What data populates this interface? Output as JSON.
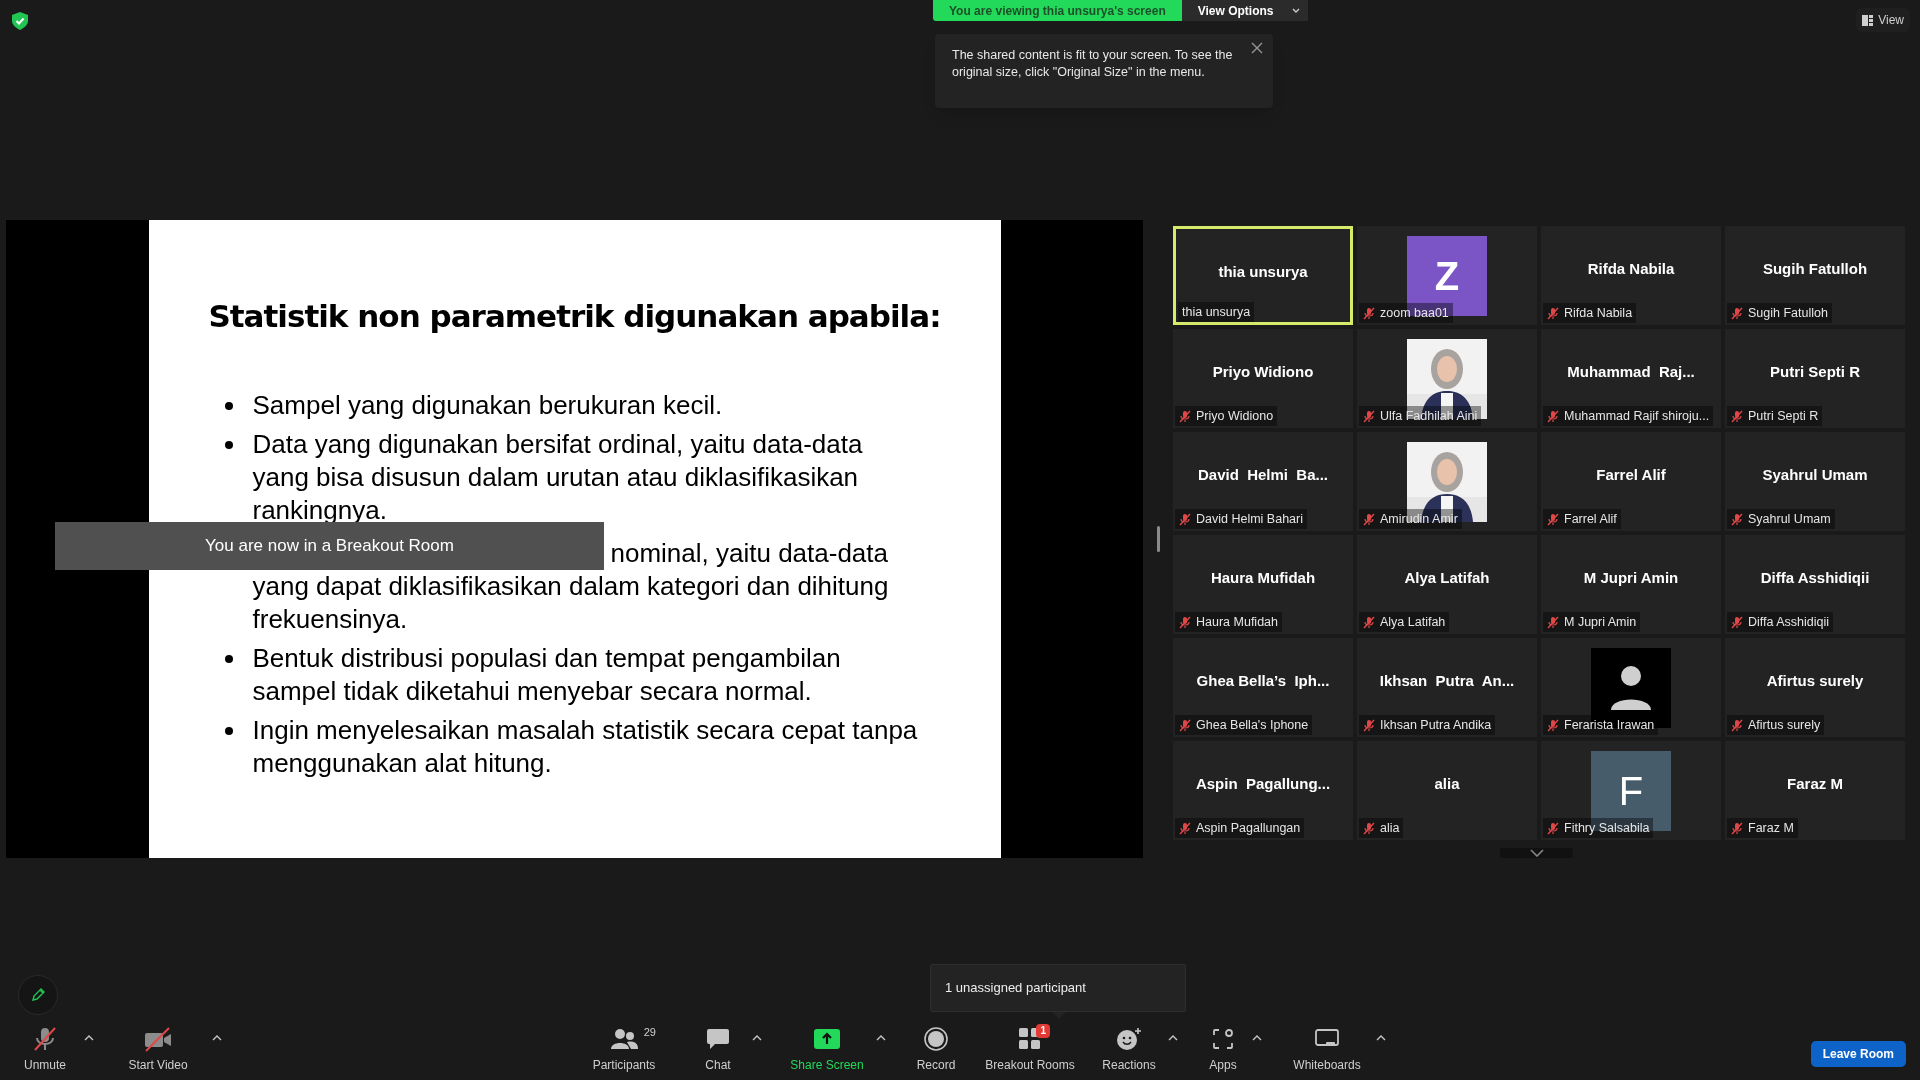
{
  "banner": {
    "text": "You are viewing thia unsurya's screen",
    "menu": "View Options"
  },
  "tooltip": {
    "text": "The shared content is fit to your screen. To see the original size, click \"Original Size\" in the menu."
  },
  "view_button": "View",
  "slide": {
    "title": "Statistik non parametrik digunakan apabila:",
    "bullets": [
      {
        "covered": false,
        "lines": [
          "Sampel yang digunakan berukuran kecil."
        ]
      },
      {
        "covered": false,
        "lines": [
          "Data yang digunakan bersifat ordinal, yaitu data-data",
          "yang bisa disusun dalam urutan atau diklasifikasikan",
          "rankingnya."
        ]
      },
      {
        "covered": true,
        "lines": [
          "nominal, yaitu data-data",
          "yang dapat diklasifikasikan dalam kategori dan dihitung",
          "frekuensinya."
        ]
      },
      {
        "covered": false,
        "lines": [
          "Bentuk distribusi populasi dan tempat pengambilan",
          "sampel tidak diketahui menyebar secara normal."
        ]
      },
      {
        "covered": false,
        "lines": [
          "Ingin menyelesaikan masalah statistik secara cepat tanpa",
          "menggunakan alat hitung."
        ]
      }
    ]
  },
  "notice": "You are now in a Breakout Room",
  "gallery": [
    {
      "kind": "name",
      "title": "thia unsurya",
      "label": "thia unsurya",
      "muted": false,
      "selected": true
    },
    {
      "kind": "letter",
      "letter": "Z",
      "color": "#7b55c6",
      "label": "zoom baa01",
      "muted": true,
      "selected": false
    },
    {
      "kind": "name",
      "title": "Rifda Nabila",
      "label": "Rifda Nabila",
      "muted": true,
      "selected": false
    },
    {
      "kind": "name",
      "title": "Sugih Fatulloh",
      "label": "Sugih Fatulloh",
      "muted": true,
      "selected": false
    },
    {
      "kind": "name",
      "title": "Priyo Widiono",
      "label": "Priyo Widiono",
      "muted": true,
      "selected": false
    },
    {
      "label": "Ulfa Fadhilah Aini",
      "muted": true,
      "selected": false
    },
    {
      "kind": "name",
      "title": "Muhammad  Raj...",
      "label": "Muhammad Rajif shiroju...",
      "muted": true,
      "selected": false
    },
    {
      "kind": "name",
      "title": "Putri Septi R",
      "label": "Putri Septi R",
      "muted": true,
      "selected": false
    },
    {
      "kind": "name",
      "title": "David  Helmi  Ba...",
      "label": "David Helmi Bahari",
      "muted": true,
      "selected": false
    },
    {
      "label": "Amirudin Amir",
      "muted": true,
      "selected": false
    },
    {
      "kind": "name",
      "title": "Farrel Alif",
      "label": "Farrel Alif",
      "muted": true,
      "selected": false
    },
    {
      "kind": "name",
      "title": "Syahrul Umam",
      "label": "Syahrul Umam",
      "muted": true,
      "selected": false
    },
    {
      "kind": "name",
      "title": "Haura Mufidah",
      "label": "Haura Mufidah",
      "muted": true,
      "selected": false
    },
    {
      "kind": "name",
      "title": "Alya Latifah",
      "label": "Alya Latifah",
      "muted": true,
      "selected": false
    },
    {
      "kind": "name",
      "title": "M Jupri Amin",
      "label": "M Jupri Amin",
      "muted": true,
      "selected": false
    },
    {
      "kind": "name",
      "title": "Diffa Asshidiqii",
      "label": "Diffa Asshidiqii",
      "muted": true,
      "selected": false
    },
    {
      "kind": "name",
      "title": "Ghea Bella’s  Iph...",
      "label": "Ghea Bella's Iphone",
      "muted": true,
      "selected": false
    },
    {
      "kind": "name",
      "title": "Ikhsan  Putra  An...",
      "label": "Ikhsan Putra Andika",
      "muted": true,
      "selected": false
    },
    {
      "kind": "silhouette",
      "label": "Ferarista Irawan",
      "muted": true,
      "selected": false
    },
    {
      "kind": "name",
      "title": "Afirtus surely",
      "label": "Afirtus surely",
      "muted": true,
      "selected": false
    },
    {
      "kind": "name",
      "title": "Aspin  Pagallung...",
      "label": "Aspin Pagallungan",
      "muted": true,
      "selected": false
    },
    {
      "kind": "name",
      "title": "alia",
      "label": "alia",
      "muted": true,
      "selected": false
    },
    {
      "kind": "letter",
      "letter": "F",
      "color": "#475c6b",
      "label": "Fithry Salsabila",
      "muted": true,
      "selected": false
    },
    {
      "kind": "name",
      "title": "Faraz M",
      "label": "Faraz M",
      "muted": true,
      "selected": false
    }
  ],
  "unassigned_tip": "1 unassigned participant",
  "toolbar": {
    "left": [
      {
        "kind": "mic-off",
        "label": "Unmute",
        "caret": true
      },
      {
        "kind": "video-off",
        "label": "Start Video",
        "caret": true
      }
    ],
    "center": [
      {
        "kind": "participants",
        "label": "Participants",
        "count": "29",
        "caret": false
      },
      {
        "kind": "chat",
        "label": "Chat",
        "caret": true
      },
      {
        "kind": "share",
        "label": "Share Screen",
        "caret": true
      },
      {
        "kind": "record",
        "label": "Record",
        "caret": false
      },
      {
        "kind": "breakout",
        "label": "Breakout Rooms",
        "badge": "1",
        "caret": false
      },
      {
        "kind": "reactions",
        "label": "Reactions",
        "caret": true
      },
      {
        "kind": "apps",
        "label": "Apps",
        "caret": true
      },
      {
        "kind": "whiteboard",
        "label": "Whiteboards",
        "caret": true
      }
    ],
    "leave": "Leave Room"
  }
}
